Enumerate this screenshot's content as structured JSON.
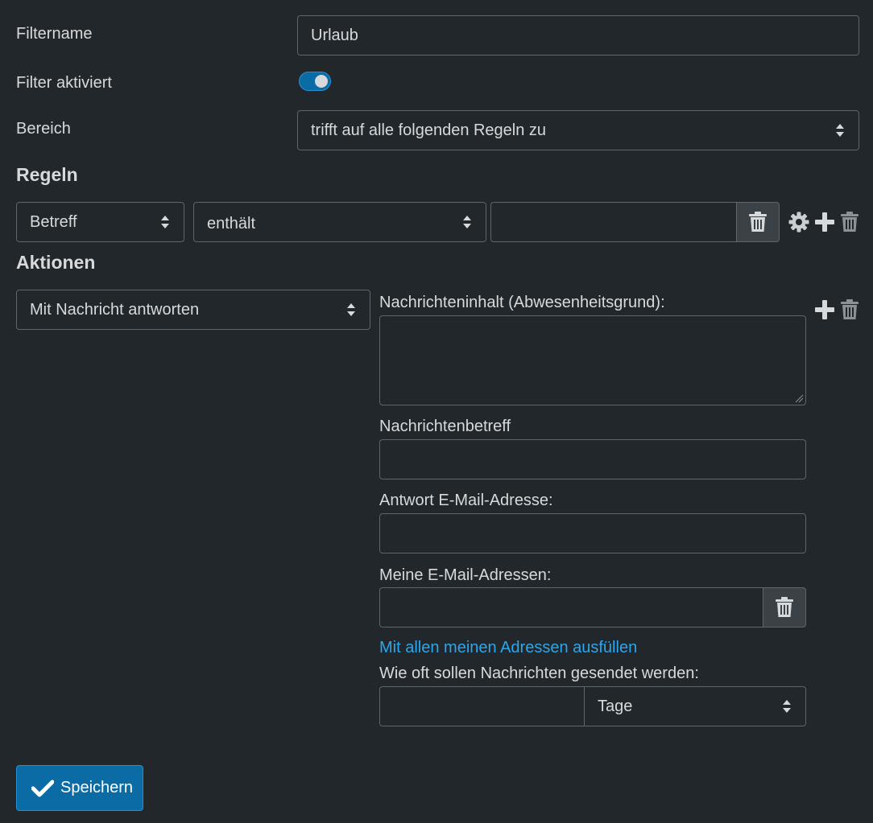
{
  "filter": {
    "name_label": "Filtername",
    "name_value": "Urlaub",
    "enabled_label": "Filter aktiviert",
    "enabled": true,
    "scope_label": "Bereich",
    "scope_value": "trifft auf alle folgenden Regeln zu"
  },
  "rules": {
    "heading": "Regeln",
    "items": [
      {
        "header": "Betreff",
        "operator": "enthält",
        "value": ""
      }
    ]
  },
  "actions": {
    "heading": "Aktionen",
    "items": [
      {
        "type": "Mit Nachricht antworten",
        "body_label": "Nachrichteninhalt (Abwesenheitsgrund):",
        "body_value": "",
        "subject_label": "Nachrichtenbetreff",
        "subject_value": "",
        "reply_address_label": "Antwort E-Mail-Adresse:",
        "reply_address_value": "",
        "my_addresses_label": "Meine E-Mail-Adressen:",
        "my_addresses_value": "",
        "fill_all_link": "Mit allen meinen Adressen ausfüllen",
        "frequency_label": "Wie oft sollen Nachrichten gesendet werden:",
        "frequency_value": "",
        "frequency_unit": "Tage"
      }
    ]
  },
  "save_label": "Speichern",
  "colors": {
    "background": "#21272b",
    "accent": "#0b6ba5",
    "link": "#2ba6ef",
    "border": "#5e666c"
  }
}
